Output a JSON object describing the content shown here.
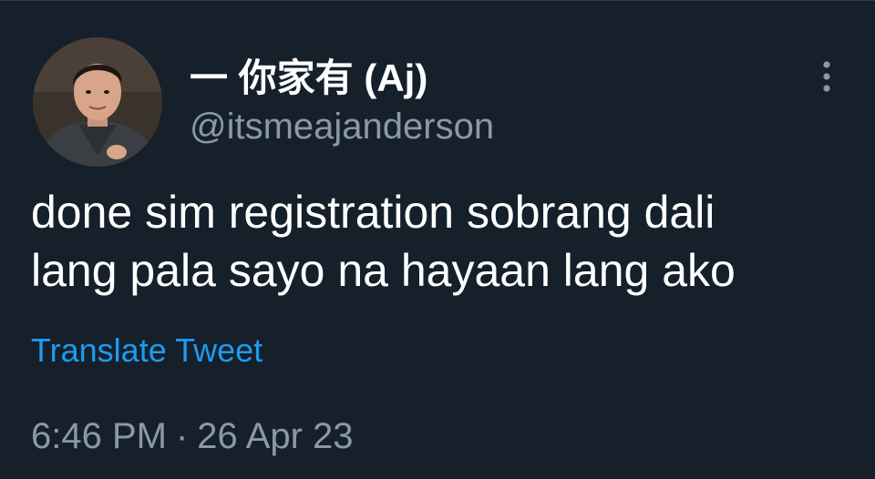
{
  "author": {
    "display_name": "一 你家有 (Aj)",
    "handle": "@itsmeajanderson"
  },
  "tweet": {
    "text_lines": [
      "done sim registration sobrang dali",
      "lang pala sayo na hayaan lang ako"
    ],
    "translate_label": "Translate Tweet",
    "time": "6:46 PM",
    "separator": "·",
    "date": "26 Apr 23"
  },
  "icons": {
    "more": "more-vertical-icon",
    "avatar": "profile-photo"
  },
  "colors": {
    "background": "#15202b",
    "text_primary": "#ffffff",
    "text_secondary": "#8b98a5",
    "accent": "#1d9bf0"
  }
}
